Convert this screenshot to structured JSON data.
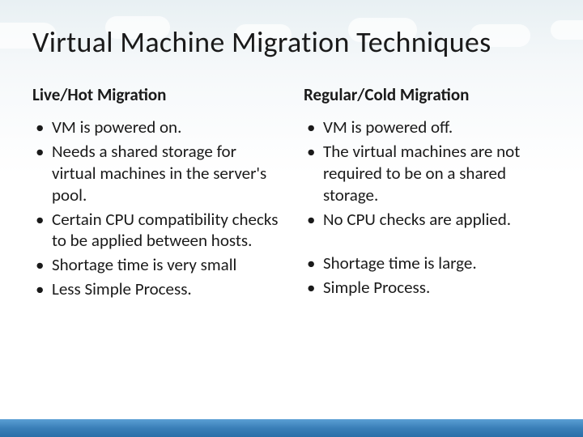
{
  "title": "Virtual Machine Migration Techniques",
  "left": {
    "heading": "Live/Hot Migration",
    "items": [
      "VM is powered on.",
      "Needs a shared storage for virtual machines in the server's pool.",
      "Certain CPU compatibility checks to be applied between hosts.",
      "Shortage time is very small",
      "Less Simple Process."
    ]
  },
  "right": {
    "heading": "Regular/Cold Migration",
    "items": [
      "VM is powered off.",
      "The virtual machines are not required to be on a shared storage.",
      "No CPU checks are applied."
    ],
    "items2": [
      "Shortage time is large.",
      "Simple Process."
    ]
  }
}
